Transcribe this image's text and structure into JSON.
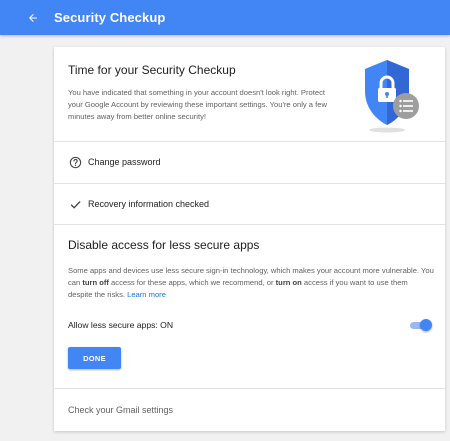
{
  "header": {
    "title": "Security Checkup",
    "back_icon": "arrow-back-icon",
    "color": "#4285f4"
  },
  "intro": {
    "title": "Time for your Security Checkup",
    "description": "You have indicated that something in your account doesn't look right. Protect your Google Account by reviewing these important settings. You're only a few minutes away from better online security!",
    "illustration_icon": "security-shield-icon"
  },
  "checks": [
    {
      "label": "Change password",
      "icon": "help-circle-icon"
    },
    {
      "label": "Recovery information checked",
      "icon": "checkmark-icon"
    }
  ],
  "less_secure_apps": {
    "title": "Disable access for less secure apps",
    "description_part1": "Some apps and devices use less secure sign-in technology, which makes your account more vulnerable. You can ",
    "bold1": "turn off",
    "description_part2": " access for these apps, which we recommend, or ",
    "bold2": "turn on",
    "description_part3": " access if you want to use them despite the risks. ",
    "learn_more": "Learn more",
    "toggle_label": "Allow less secure apps: ON",
    "toggle_on": true,
    "done_label": "DONE"
  },
  "gmail": {
    "label": "Check your Gmail settings"
  },
  "colors": {
    "accent": "#4285f4",
    "link": "#1a73e8"
  }
}
